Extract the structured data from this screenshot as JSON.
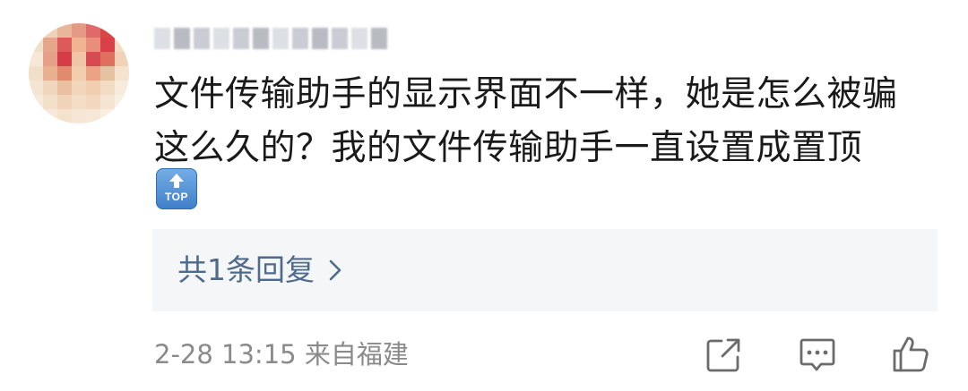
{
  "comment": {
    "username": "",
    "text_lines": [
      "文件传输助手的显示界面不一样，她是怎么被骗",
      "这么久的？我的文件传输助手一直设置成置顶"
    ],
    "emoji": {
      "name": "top-arrow-icon",
      "label": "TOP"
    }
  },
  "replies": {
    "label": "共1条回复",
    "chevron": "chevron-right-icon"
  },
  "meta": {
    "time_location": "2-28 13:15 来自福建"
  },
  "actions": [
    {
      "name": "share-icon"
    },
    {
      "name": "comment-icon"
    },
    {
      "name": "like-icon"
    }
  ],
  "colors": {
    "text": "#1a1a1a",
    "link": "#4f6b8c",
    "meta": "#8a8a8a",
    "reply_bg": "#f5f6f7",
    "icon": "#6b6b6b"
  }
}
